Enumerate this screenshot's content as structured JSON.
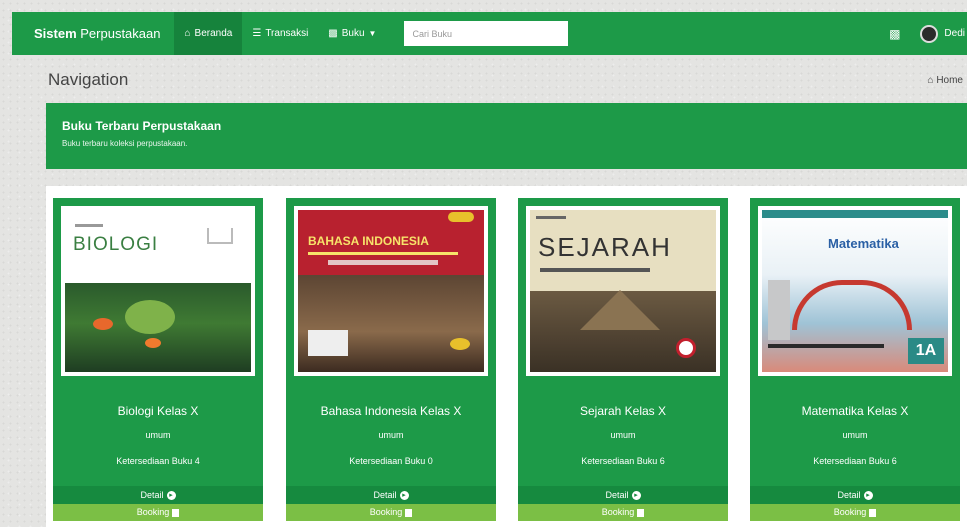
{
  "navbar": {
    "brand_bold": "Sistem",
    "brand_rest": " Perpustakaan",
    "items": [
      {
        "label": "Beranda",
        "icon": "home-icon"
      },
      {
        "label": "Transaksi",
        "icon": "list-icon"
      },
      {
        "label": "Buku",
        "icon": "book-icon"
      }
    ],
    "search_placeholder": "Cari Buku",
    "user_name": "Dedi"
  },
  "header": {
    "title": "Navigation",
    "breadcrumb": "Home"
  },
  "banner": {
    "title": "Buku Terbaru Perpustakaan",
    "subtitle": "Buku terbaru koleksi perpustakaan."
  },
  "books": [
    {
      "title": "Biologi Kelas X",
      "category": "umum",
      "stock": "Ketersediaan Buku 4",
      "detail": "Detail",
      "booking": "Booking",
      "cover_title": "BIOLOGI"
    },
    {
      "title": "Bahasa Indonesia Kelas X",
      "category": "umum",
      "stock": "Ketersediaan Buku 0",
      "detail": "Detail",
      "booking": "Booking",
      "cover_title": "BAHASA INDONESIA"
    },
    {
      "title": "Sejarah Kelas X",
      "category": "umum",
      "stock": "Ketersediaan Buku 6",
      "detail": "Detail",
      "booking": "Booking",
      "cover_title": "SEJARAH"
    },
    {
      "title": "Matematika Kelas X",
      "category": "umum",
      "stock": "Ketersediaan Buku 6",
      "detail": "Detail",
      "booking": "Booking",
      "cover_title": "Matematika"
    }
  ],
  "colors": {
    "primary": "#1d9a48",
    "primary_dark": "#168a3f",
    "booking": "#7bbf45"
  }
}
